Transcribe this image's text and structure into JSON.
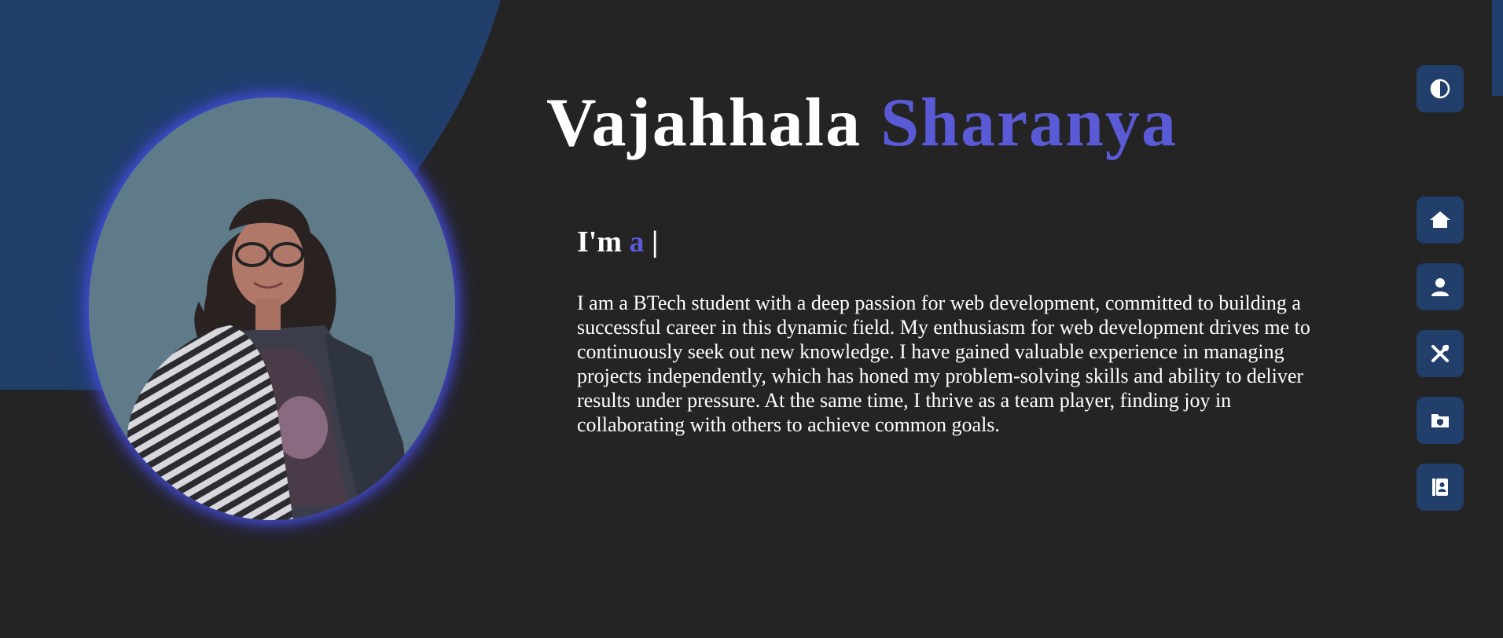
{
  "hero": {
    "first_name": "Vajahhala",
    "last_name": "Sharanya",
    "im_prefix": "I'm",
    "im_role": "a",
    "im_cursor": "|",
    "about": "I am a BTech student with a deep passion for web development, committed to building a successful career in this dynamic field. My enthusiasm for web development drives me to continuously seek out new knowledge. I have gained valuable experience in managing projects independently, which has honed my problem-solving skills and ability to deliver results under pressure. At the same time, I thrive as a team player, finding joy in collaborating with others to achieve common goals."
  },
  "nav": {
    "items": [
      {
        "icon": "contrast-icon"
      },
      {
        "icon": "home-icon"
      },
      {
        "icon": "user-icon"
      },
      {
        "icon": "tools-icon"
      },
      {
        "icon": "folder-icon"
      },
      {
        "icon": "contact-book-icon"
      }
    ]
  },
  "colors": {
    "background": "#242424",
    "blue": "#213f6a",
    "accent": "#5a5ad6",
    "text": "#ffffff"
  }
}
